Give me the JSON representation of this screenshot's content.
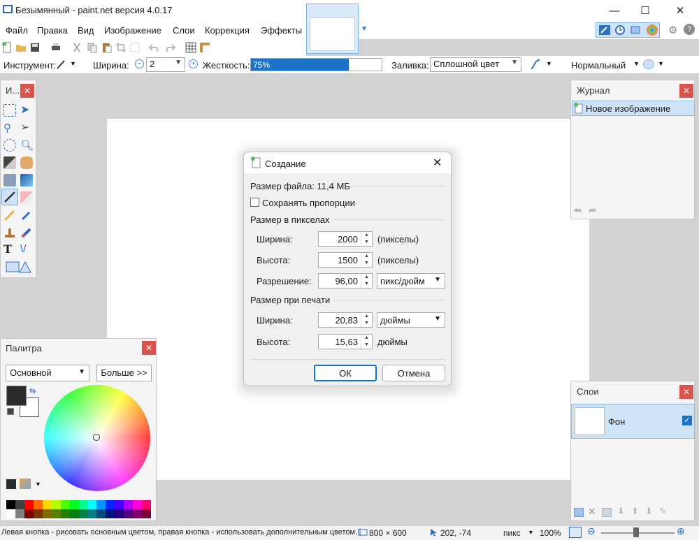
{
  "window": {
    "title": "Безымянный - paint.net версия 4.0.17",
    "minimize": "—",
    "maximize": "☐",
    "close": "✕"
  },
  "menu": {
    "items": [
      "Файл",
      "Правка",
      "Вид",
      "Изображение",
      "Слои",
      "Коррекция",
      "Эффекты"
    ]
  },
  "toolbar": {
    "tool_label": "Инструмент:",
    "width_label": "Ширина:",
    "width_value": "2",
    "hardness_label": "Жесткость:",
    "hardness_text": "75%",
    "hardness_value": 0.75,
    "fill_label": "Заливка:",
    "fill_value": "Сплошной цвет",
    "blend_value": "Нормальный"
  },
  "tools_panel": {
    "title": "И..."
  },
  "history_panel": {
    "title": "Журнал",
    "items": [
      "Новое изображение"
    ]
  },
  "palette_panel": {
    "title": "Палитра",
    "mode_value": "Основной",
    "more_button": "Больше >>"
  },
  "layers_panel": {
    "title": "Слои",
    "layers": [
      "Фон"
    ]
  },
  "dialog": {
    "title": "Создание",
    "file_size": "Размер файла: 11,4 МБ",
    "keep_proportions": "Сохранять пропорции",
    "pixel_size_section": "Размер в пикселах",
    "width_label": "Ширина:",
    "width_value": "2000",
    "width_unit": "(пикселы)",
    "height_label": "Высота:",
    "height_value": "1500",
    "height_unit": "(пикселы)",
    "resolution_label": "Разрешение:",
    "resolution_value": "96,00",
    "resolution_unit": "пикс/дюйм",
    "print_size_section": "Размер при печати",
    "print_width_label": "Ширина:",
    "print_width_value": "20,83",
    "print_width_unit": "дюймы",
    "print_height_label": "Высота:",
    "print_height_value": "15,63",
    "print_height_unit": "дюймы",
    "ok_button": "ОК",
    "cancel_button": "Отмена"
  },
  "status": {
    "hint": "Левая кнопка - рисовать основным цветом, правая кнопка - использовать дополнительным цветом.",
    "image_size": "800 × 600",
    "cursor_pos": "202, -74",
    "units": "пикс",
    "zoom": "100%"
  },
  "colors": {
    "accent": "#1a73c9",
    "close_red": "#d9534f",
    "primary_color": "#2b2b2b",
    "secondary_color": "#ffffff"
  }
}
